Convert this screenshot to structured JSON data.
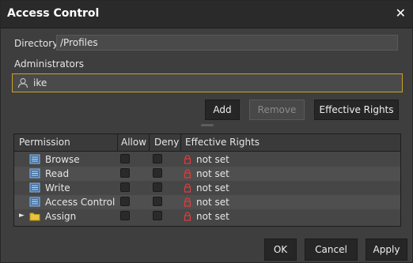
{
  "dialog": {
    "title": "Access Control",
    "close_glyph": "✕"
  },
  "directory": {
    "label": "Directory:",
    "value": "/Profiles"
  },
  "administrators": {
    "label": "Administrators",
    "entries": [
      "ike"
    ],
    "icon": "user-icon"
  },
  "buttons": {
    "add": "Add",
    "remove": "Remove",
    "effective_rights": "Effective Rights",
    "ok": "OK",
    "cancel": "Cancel",
    "apply": "Apply"
  },
  "table": {
    "headers": {
      "permission": "Permission",
      "allow": "Allow",
      "deny": "Deny",
      "effective_rights": "Effective Rights"
    },
    "rows": [
      {
        "name": "Browse",
        "icon": "permission-icon",
        "allow": false,
        "deny": false,
        "effective": "not set"
      },
      {
        "name": "Read",
        "icon": "permission-icon",
        "allow": false,
        "deny": false,
        "effective": "not set"
      },
      {
        "name": "Write",
        "icon": "permission-icon",
        "allow": false,
        "deny": false,
        "effective": "not set"
      },
      {
        "name": "Access Control",
        "icon": "permission-icon",
        "allow": false,
        "deny": false,
        "effective": "not set"
      },
      {
        "name": "Assign",
        "icon": "folder-icon",
        "expandable": true,
        "allow": false,
        "deny": false,
        "effective": "not set"
      }
    ]
  },
  "colors": {
    "focus_border": "#c9a227",
    "lock_red": "#e03c3c",
    "folder_yellow": "#e8c43a",
    "perm_blue": "#6fa3d8"
  }
}
